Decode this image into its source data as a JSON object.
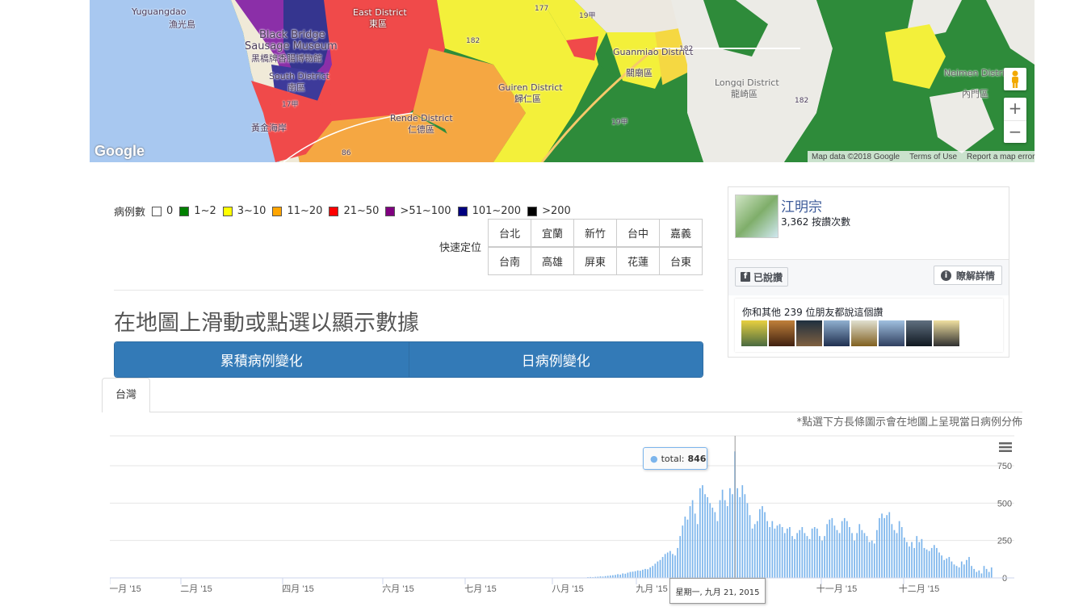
{
  "map": {
    "labels": [
      {
        "text": "Yuguangdao",
        "cls": "a"
      },
      {
        "text": "漁光島",
        "cls": "b"
      },
      {
        "text": "East District",
        "cls": "c"
      },
      {
        "text": "東區",
        "cls": "d"
      },
      {
        "text": "Black Bridge",
        "cls": "e"
      },
      {
        "text": "Sausage Museum",
        "cls": "f"
      },
      {
        "text": "黑橋牌香腸博物館",
        "cls": "g"
      },
      {
        "text": "South District",
        "cls": "h"
      },
      {
        "text": "南區",
        "cls": "i"
      },
      {
        "text": "Guiren District",
        "cls": "j"
      },
      {
        "text": "歸仁區",
        "cls": "k"
      },
      {
        "text": "Rende District",
        "cls": "l"
      },
      {
        "text": "仁德區",
        "cls": "m"
      },
      {
        "text": "黃金海岸",
        "cls": "n"
      },
      {
        "text": "Guanmiao District",
        "cls": "o"
      },
      {
        "text": "關廟區",
        "cls": "p"
      },
      {
        "text": "Longqi District",
        "cls": "q"
      },
      {
        "text": "龍崎區",
        "cls": "r"
      },
      {
        "text": "Neimen District",
        "cls": "s"
      },
      {
        "text": "內門區",
        "cls": "t"
      }
    ],
    "road_labels": [
      "177",
      "19甲",
      "182",
      "17甲",
      "86",
      "182",
      "182",
      "19甲"
    ],
    "google_logo": "Google",
    "attribution": {
      "map_data": "Map data ©2018 Google",
      "terms": "Terms of Use",
      "report": "Report a map error"
    },
    "zoom_in": "+",
    "zoom_out": "−"
  },
  "legend": {
    "title": "病例數",
    "items": [
      {
        "label": "0",
        "color": "#ffffff"
      },
      {
        "label": "1~2",
        "color": "#008000"
      },
      {
        "label": "3~10",
        "color": "#ffff00"
      },
      {
        "label": "11~20",
        "color": "#ffa500"
      },
      {
        "label": "21~50",
        "color": "#ff0000"
      },
      {
        "label": ">51~100",
        "color": "#800080"
      },
      {
        "label": "101~200",
        "color": "#000080"
      },
      {
        "label": ">200",
        "color": "#000000"
      }
    ]
  },
  "quick_locate": {
    "label": "快速定位",
    "row1": [
      "台北",
      "宜蘭",
      "新竹",
      "台中",
      "嘉義"
    ],
    "row2": [
      "台南",
      "高雄",
      "屏東",
      "花蓮",
      "台東"
    ]
  },
  "headline": "在地圖上滑動或點選以顯示數據",
  "buttons": {
    "cumulative": "累積病例變化",
    "daily": "日病例變化"
  },
  "tab": {
    "label": "台灣"
  },
  "note": "*點選下方長條圖示會在地圖上呈現當日病例分佈",
  "facebook": {
    "name": "江明宗",
    "likes": "3,362 按讚次數",
    "liked_button": "已說讚",
    "learn_more": "瞭解詳情",
    "friends_text": "你和其他 239 位朋友都說這個讚"
  },
  "tooltip": {
    "series": "total:",
    "value": "846",
    "date": "星期一, 九月 21, 2015"
  },
  "chart_data": {
    "type": "bar",
    "title": "",
    "series": [
      {
        "name": "total"
      }
    ],
    "x_ticks": [
      "一月 '15",
      "二月 '15",
      "四月 '15",
      "六月 '15",
      "七月 '15",
      "八月 '15",
      "九月 '15",
      "十一月 '15",
      "十二月 '15"
    ],
    "y_ticks": [
      "0",
      "250",
      "500",
      "750"
    ],
    "ylim": [
      0,
      950
    ],
    "grid": true,
    "x_start": "2015-01-01",
    "values": [
      0,
      2,
      1,
      0,
      0,
      1,
      0,
      0,
      1,
      0,
      0,
      0,
      0,
      0,
      0,
      0,
      0,
      0,
      0,
      0,
      0,
      0,
      0,
      0,
      0,
      0,
      0,
      0,
      0,
      0,
      0,
      0,
      0,
      0,
      0,
      0,
      0,
      0,
      0,
      0,
      0,
      0,
      0,
      0,
      0,
      0,
      0,
      0,
      0,
      0,
      0,
      0,
      0,
      0,
      0,
      0,
      0,
      0,
      0,
      0,
      0,
      0,
      0,
      0,
      0,
      0,
      0,
      0,
      0,
      0,
      0,
      0,
      0,
      0,
      0,
      0,
      0,
      0,
      0,
      0,
      0,
      0,
      0,
      0,
      0,
      0,
      0,
      0,
      0,
      0,
      0,
      0,
      0,
      0,
      0,
      0,
      0,
      0,
      0,
      0,
      0,
      0,
      0,
      0,
      0,
      0,
      0,
      0,
      0,
      0,
      0,
      0,
      0,
      0,
      0,
      0,
      0,
      0,
      0,
      0,
      0,
      0,
      0,
      0,
      0,
      0,
      0,
      0,
      0,
      0,
      0,
      0,
      0,
      0,
      0,
      0,
      0,
      0,
      0,
      0,
      0,
      0,
      0,
      0,
      0,
      0,
      0,
      0,
      0,
      0,
      0,
      0,
      0,
      0,
      0,
      0,
      0,
      0,
      0,
      0,
      0,
      0,
      0,
      0,
      0,
      0,
      0,
      0,
      0,
      0,
      0,
      0,
      0,
      0,
      0,
      0,
      0,
      0,
      0,
      0,
      0,
      0,
      0,
      0,
      0,
      0,
      0,
      0,
      0,
      0,
      0,
      5,
      6,
      5,
      7,
      8,
      10,
      9,
      12,
      14,
      16,
      18,
      20,
      25,
      22,
      30,
      28,
      35,
      40,
      42,
      45,
      50,
      48,
      55,
      60,
      58,
      70,
      80,
      95,
      110,
      120,
      140,
      160,
      170,
      180,
      160,
      150,
      200,
      280,
      350,
      410,
      390,
      480,
      520,
      430,
      360,
      600,
      620,
      560,
      540,
      500,
      470,
      440,
      380,
      520,
      590,
      520,
      480,
      600,
      560,
      846,
      600,
      540,
      620,
      560,
      500,
      420,
      330,
      360,
      380,
      460,
      480,
      440,
      380,
      340,
      380,
      330,
      350,
      360,
      340,
      300,
      330,
      340,
      280,
      260,
      300,
      320,
      340,
      300,
      280,
      260,
      330,
      340,
      330,
      280,
      250,
      280,
      360,
      390,
      400,
      350,
      320,
      300,
      380,
      400,
      380,
      340,
      300,
      250,
      300,
      360,
      320,
      300,
      280,
      240,
      250,
      230,
      320,
      400,
      430,
      400,
      420,
      440,
      360,
      320,
      300,
      380,
      340,
      270,
      240,
      210,
      240,
      200,
      280,
      240,
      260,
      200,
      190,
      180,
      200,
      220,
      200,
      170,
      150,
      120,
      130,
      140,
      110,
      90,
      80,
      70,
      110,
      90,
      120,
      140,
      80,
      60,
      40,
      50,
      30,
      80,
      60,
      40,
      70
    ]
  }
}
